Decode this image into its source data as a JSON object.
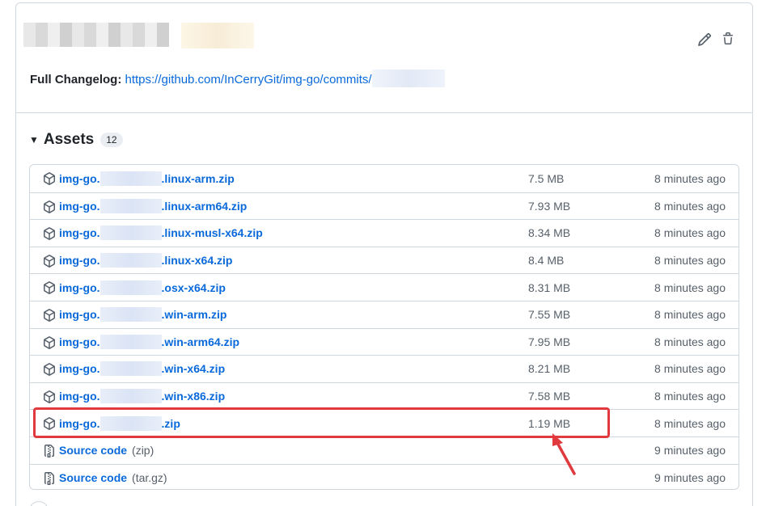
{
  "release": {
    "changelog_label": "Full Changelog:",
    "changelog_link": "https://github.com/InCerryGit/img-go/commits/"
  },
  "assets": {
    "title": "Assets",
    "count": "12",
    "rows": [
      {
        "prefix": "img-go.",
        "suffix": ".linux-arm.zip",
        "size": "7.5 MB",
        "time": "8 minutes ago",
        "icon": "package-icon"
      },
      {
        "prefix": "img-go.",
        "suffix": ".linux-arm64.zip",
        "size": "7.93 MB",
        "time": "8 minutes ago",
        "icon": "package-icon"
      },
      {
        "prefix": "img-go.",
        "suffix": ".linux-musl-x64.zip",
        "size": "8.34 MB",
        "time": "8 minutes ago",
        "icon": "package-icon"
      },
      {
        "prefix": "img-go.",
        "suffix": ".linux-x64.zip",
        "size": "8.4 MB",
        "time": "8 minutes ago",
        "icon": "package-icon"
      },
      {
        "prefix": "img-go.",
        "suffix": ".osx-x64.zip",
        "size": "8.31 MB",
        "time": "8 minutes ago",
        "icon": "package-icon"
      },
      {
        "prefix": "img-go.",
        "suffix": ".win-arm.zip",
        "size": "7.55 MB",
        "time": "8 minutes ago",
        "icon": "package-icon"
      },
      {
        "prefix": "img-go.",
        "suffix": ".win-arm64.zip",
        "size": "7.95 MB",
        "time": "8 minutes ago",
        "icon": "package-icon"
      },
      {
        "prefix": "img-go.",
        "suffix": ".win-x64.zip",
        "size": "8.21 MB",
        "time": "8 minutes ago",
        "icon": "package-icon"
      },
      {
        "prefix": "img-go.",
        "suffix": ".win-x86.zip",
        "size": "7.58 MB",
        "time": "8 minutes ago",
        "icon": "package-icon"
      },
      {
        "prefix": "img-go.",
        "suffix": ".zip",
        "size": "1.19 MB",
        "time": "8 minutes ago",
        "icon": "package-icon"
      },
      {
        "prefix": "Source code",
        "suffix": "",
        "format": "(zip)",
        "size": "",
        "time": "9 minutes ago",
        "icon": "file-zip-icon"
      },
      {
        "prefix": "Source code",
        "suffix": "",
        "format": "(tar.gz)",
        "size": "",
        "time": "9 minutes ago",
        "icon": "file-zip-icon"
      }
    ]
  },
  "colors": {
    "link": "#0969da",
    "muted": "#57606a",
    "border": "#d0d7de",
    "highlight": "#e0393e"
  }
}
